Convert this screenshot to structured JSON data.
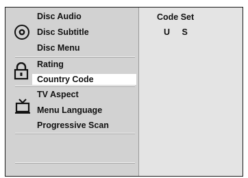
{
  "menu": {
    "groups": [
      {
        "icon": "disc-icon",
        "items": [
          "Disc Audio",
          "Disc Subtitle",
          "Disc Menu"
        ]
      },
      {
        "icon": "lock-icon",
        "items": [
          "Rating",
          "Country Code"
        ]
      },
      {
        "icon": "tv-icon",
        "items": [
          "TV Aspect",
          "Menu Language",
          "Progressive Scan"
        ]
      }
    ],
    "selected": "Country Code"
  },
  "panel": {
    "title": "Code Set",
    "value": "U S"
  },
  "colors": {
    "menu_bg": "#d2d2d2",
    "panel_bg": "#e4e4e4",
    "highlight": "#ffffff",
    "text": "#111111"
  }
}
